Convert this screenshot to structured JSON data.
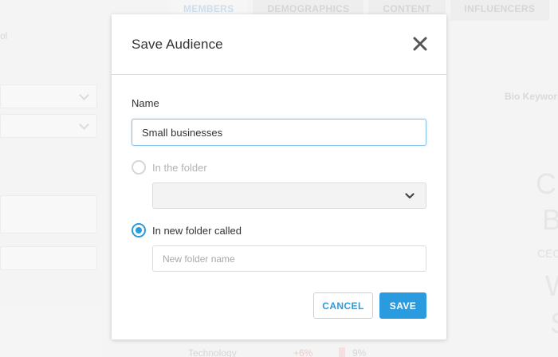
{
  "background": {
    "tabs": [
      "MEMBERS",
      "DEMOGRAPHICS",
      "CONTENT",
      "INFLUENCERS"
    ],
    "left_fragment": "ol",
    "right_header": "Bio Keywor",
    "table_row_label": "Technology",
    "table_row_change": "+6%",
    "table_row_value": "9%",
    "right_letters": [
      "C",
      "B",
      "CEO",
      "W",
      "S"
    ]
  },
  "modal": {
    "title": "Save Audience",
    "name_label": "Name",
    "name_value": "Small businesses",
    "option_existing_folder": "In the folder",
    "option_new_folder": "In new folder called",
    "new_folder_placeholder": "New folder name",
    "cancel_label": "CANCEL",
    "save_label": "SAVE"
  },
  "colors": {
    "accent": "#2b9be0",
    "input_focus_border": "#8cc3ea"
  },
  "icons": {
    "close": "close-icon",
    "select_chevron": "chevron-down-icon"
  }
}
